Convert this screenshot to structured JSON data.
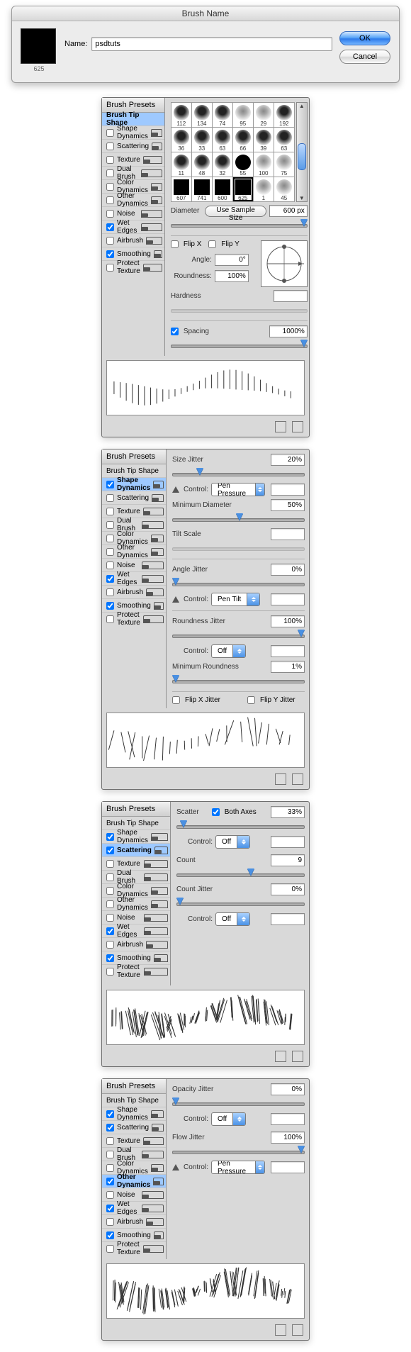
{
  "dialog": {
    "title": "Brush Name",
    "thumb_caption": "625",
    "name_label": "Name:",
    "name_value": "psdtuts",
    "ok": "OK",
    "cancel": "Cancel"
  },
  "side": {
    "header": "Brush Presets",
    "items": [
      {
        "label": "Brush Tip Shape",
        "check": null
      },
      {
        "label": "Shape Dynamics",
        "check": false
      },
      {
        "label": "Scattering",
        "check": false
      },
      {
        "label": "Texture",
        "check": false
      },
      {
        "label": "Dual Brush",
        "check": false
      },
      {
        "label": "Color Dynamics",
        "check": false
      },
      {
        "label": "Other Dynamics",
        "check": false
      },
      {
        "label": "Noise",
        "check": false
      },
      {
        "label": "Wet Edges",
        "check": true
      },
      {
        "label": "Airbrush",
        "check": false
      },
      {
        "label": "Smoothing",
        "check": true
      },
      {
        "label": "Protect Texture",
        "check": false
      }
    ]
  },
  "panel1": {
    "presets": [
      {
        "n": "112"
      },
      {
        "n": "134"
      },
      {
        "n": "74"
      },
      {
        "n": "95"
      },
      {
        "n": "29"
      },
      {
        "n": "192"
      },
      {
        "n": "36"
      },
      {
        "n": "33"
      },
      {
        "n": "63"
      },
      {
        "n": "66"
      },
      {
        "n": "39"
      },
      {
        "n": "63"
      },
      {
        "n": "11"
      },
      {
        "n": "48"
      },
      {
        "n": "32"
      },
      {
        "n": "55"
      },
      {
        "n": "100"
      },
      {
        "n": "75"
      },
      {
        "n": "607"
      },
      {
        "n": "741"
      },
      {
        "n": "600"
      },
      {
        "n": "625"
      },
      {
        "n": "1"
      },
      {
        "n": "45"
      }
    ],
    "diameter_label": "Diameter",
    "use_sample": "Use Sample Size",
    "diameter_value": "600 px",
    "flipx": "Flip X",
    "flipy": "Flip Y",
    "angle_label": "Angle:",
    "angle_value": "0°",
    "round_label": "Roundness:",
    "round_value": "100%",
    "hard_label": "Hardness",
    "spacing_label": "Spacing",
    "spacing_value": "1000%"
  },
  "panel2": {
    "size_jitter": "Size Jitter",
    "size_jitter_v": "20%",
    "control": "Control:",
    "pen_pressure": "Pen Pressure",
    "min_dia": "Minimum Diameter",
    "min_dia_v": "50%",
    "tilt": "Tilt Scale",
    "angle_jitter": "Angle Jitter",
    "angle_jitter_v": "0%",
    "pen_tilt": "Pen Tilt",
    "round_jitter": "Roundness Jitter",
    "round_jitter_v": "100%",
    "off": "Off",
    "min_round": "Minimum Roundness",
    "min_round_v": "1%",
    "flipxj": "Flip X Jitter",
    "flipyj": "Flip Y Jitter",
    "side_shape_on": true
  },
  "panel3": {
    "scatter": "Scatter",
    "both_axes": "Both Axes",
    "scatter_v": "33%",
    "control": "Control:",
    "off": "Off",
    "count": "Count",
    "count_v": "9",
    "count_jitter": "Count Jitter",
    "count_jitter_v": "0%"
  },
  "panel4": {
    "opacity_jitter": "Opacity Jitter",
    "opacity_jitter_v": "0%",
    "control": "Control:",
    "off": "Off",
    "pen_pressure": "Pen Pressure",
    "flow_jitter": "Flow Jitter",
    "flow_jitter_v": "100%"
  }
}
